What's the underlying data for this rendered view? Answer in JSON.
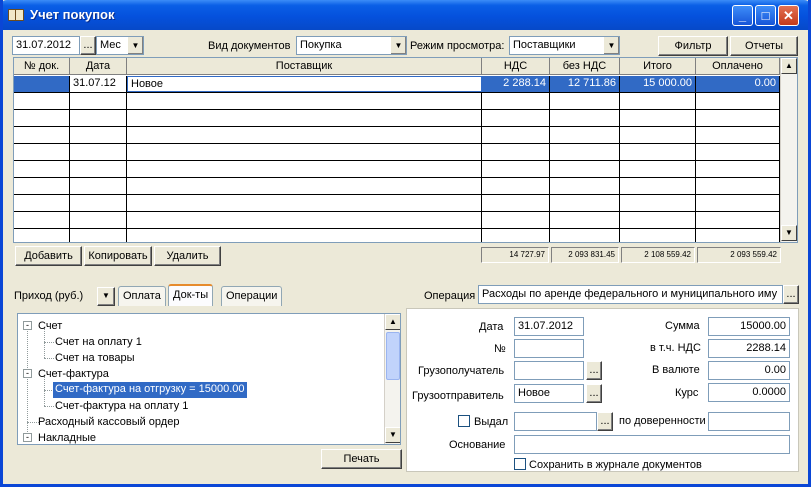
{
  "window": {
    "title": "Учет покупок"
  },
  "toolbar": {
    "date": "31.07.2012",
    "date_picker": "...",
    "period": "Мес",
    "doctype_label": "Вид документов",
    "doctype_value": "Покупка",
    "viewmode_label": "Режим просмотра:",
    "viewmode_value": "Поставщики",
    "filter_label": "Фильтр",
    "reports_label": "Отчеты"
  },
  "table": {
    "columns": [
      "№ док.",
      "Дата",
      "Поставщик",
      "НДС",
      "без НДС",
      "Итого",
      "Оплачено"
    ],
    "rows": [
      {
        "doc_no": "",
        "date": "31.07.12",
        "supplier": "Новое",
        "vat": "2 288.14",
        "no_vat": "12 711.86",
        "total": "15 000.00",
        "paid": "0.00"
      }
    ],
    "totals": {
      "vat": "14 727.97",
      "no_vat": "2 093 831.45",
      "total": "2 108 559.42",
      "paid": "2 093 559.42"
    }
  },
  "actions": {
    "add": "Добавить",
    "copy": "Копировать",
    "delete": "Удалить"
  },
  "tabs": {
    "income": "Приход (руб.)",
    "payment": "Оплата",
    "docs": "Док-ты",
    "operations": "Операции"
  },
  "operation": {
    "label": "Операция",
    "value": "Расходы по аренде федерального и муниципального иму"
  },
  "tree": {
    "nodes": [
      {
        "label": "Счет",
        "level": 0,
        "expander": "-"
      },
      {
        "label": "Счет на оплату 1",
        "level": 1
      },
      {
        "label": "Счет на товары",
        "level": 1
      },
      {
        "label": "Счет-фактура",
        "level": 0,
        "expander": "-"
      },
      {
        "label": "Счет-фактура на отгрузку = 15000.00",
        "level": 1,
        "selected": true
      },
      {
        "label": "Счет-фактура на оплату 1",
        "level": 1
      },
      {
        "label": "Расходный кассовый ордер",
        "level": 0
      },
      {
        "label": "Накладные",
        "level": 0,
        "expander": "-"
      }
    ]
  },
  "print_label": "Печать",
  "details": {
    "date_label": "Дата",
    "date_value": "31.07.2012",
    "num_label": "№",
    "num_value": "",
    "consignee_label": "Грузополучатель",
    "consignee_value": "",
    "shipper_label": "Грузоотправитель",
    "shipper_value": "Новое",
    "issued_label": "Выдал",
    "issued_value": "",
    "proxy_label": "по доверенности",
    "proxy_value": "",
    "basis_label": "Основание",
    "basis_value": "",
    "save_journal_label": "Сохранить в журнале документов",
    "sum_label": "Сумма",
    "sum_value": "15000.00",
    "vat_incl_label": "в т.ч. НДС",
    "vat_incl_value": "2288.14",
    "currency_label": "В валюте",
    "currency_value": "0.00",
    "rate_label": "Курс",
    "rate_value": "0.0000"
  },
  "ellipsis": "..."
}
